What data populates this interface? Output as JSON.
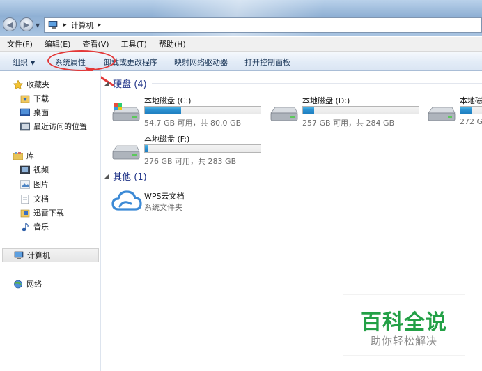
{
  "address": {
    "separator_1": "▸",
    "location": "计算机",
    "separator_2": "▸"
  },
  "menubar": [
    {
      "label": "文件(F)"
    },
    {
      "label": "编辑(E)"
    },
    {
      "label": "查看(V)"
    },
    {
      "label": "工具(T)"
    },
    {
      "label": "帮助(H)"
    }
  ],
  "toolbar": {
    "organize": "组织",
    "system_properties": "系统属性",
    "uninstall": "卸载或更改程序",
    "map_drive": "映射网络驱动器",
    "control_panel": "打开控制面板"
  },
  "sidebar": {
    "favorites": "收藏夹",
    "downloads": "下载",
    "desktop": "桌面",
    "recent": "最近访问的位置",
    "libraries": "库",
    "videos": "视频",
    "pictures": "图片",
    "documents": "文档",
    "thunder": "迅雷下载",
    "music": "音乐",
    "computer": "计算机",
    "network": "网络"
  },
  "content": {
    "hard_disks_title": "硬盘 (4)",
    "other_title": "其他 (1)",
    "drives": [
      {
        "name": "本地磁盘 (C:)",
        "free": "54.7 GB 可用，共 80.0 GB",
        "used_fraction": 0.316
      },
      {
        "name": "本地磁盘 (D:)",
        "free": "257 GB 可用，共 284 GB",
        "used_fraction": 0.095
      },
      {
        "name": "本地磁盘",
        "free": "272 G",
        "used_fraction": 0.1
      },
      {
        "name": "本地磁盘 (F:)",
        "free": "276 GB 可用，共 283 GB",
        "used_fraction": 0.025
      }
    ],
    "cloud": {
      "name": "WPS云文档",
      "type": "系统文件夹"
    }
  },
  "watermark": {
    "main": "百科全说",
    "sub": "助你轻松解决"
  },
  "colors": {
    "accent_red": "#e33838",
    "drive_fill": "#2a8fd0",
    "section_title": "#1e3287",
    "watermark_green": "#23a046"
  }
}
